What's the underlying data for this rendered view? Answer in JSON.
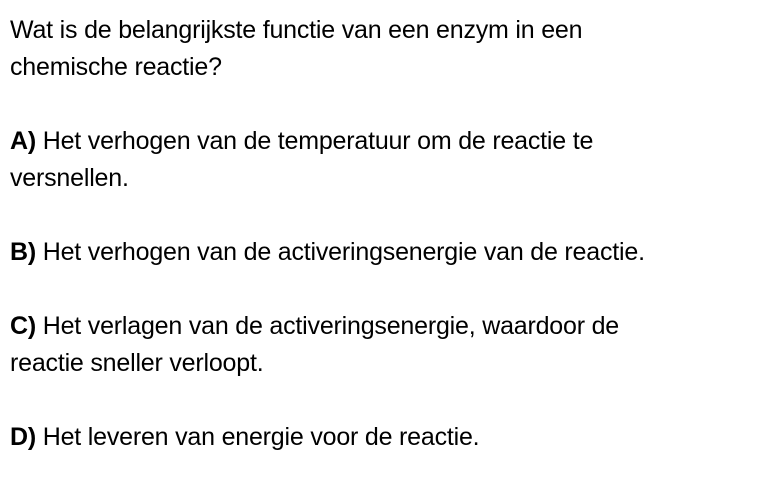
{
  "question": {
    "line1": "Wat is de belangrijkste functie van een enzym in een",
    "line2": "chemische reactie?"
  },
  "options": [
    {
      "letter": "A)",
      "line1": " Het verhogen van de temperatuur om de reactie te",
      "line2": "versnellen."
    },
    {
      "letter": "B)",
      "line1": " Het verhogen van de activeringsenergie van de reactie.",
      "line2": ""
    },
    {
      "letter": "C)",
      "line1": " Het verlagen van de activeringsenergie, waardoor de",
      "line2": "reactie sneller verloopt."
    },
    {
      "letter": "D)",
      "line1": " Het leveren van energie voor de reactie.",
      "line2": ""
    }
  ]
}
